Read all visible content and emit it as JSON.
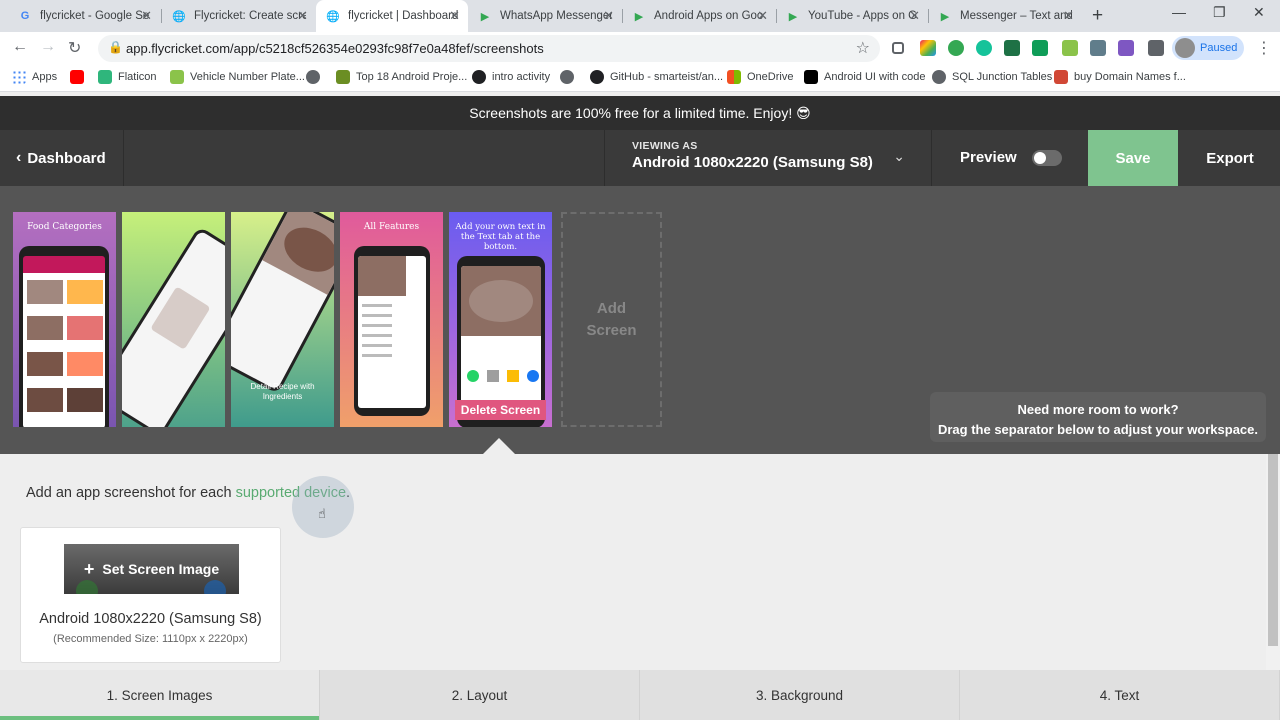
{
  "browser": {
    "tabs": [
      {
        "title": "flycricket - Google Se",
        "icon": "google-icon"
      },
      {
        "title": "Flycricket: Create scre",
        "icon": "globe-icon"
      },
      {
        "title": "flycricket | Dashboard",
        "icon": "globe-icon",
        "active": true
      },
      {
        "title": "WhatsApp Messenger",
        "icon": "play-store-icon"
      },
      {
        "title": "Android Apps on Goo",
        "icon": "play-store-icon"
      },
      {
        "title": "YouTube - Apps on G",
        "icon": "play-store-icon"
      },
      {
        "title": "Messenger – Text and",
        "icon": "play-store-icon"
      }
    ],
    "url": "app.flycricket.com/app/c5218cf526354e0293fc98f7e0a48fef/screenshots",
    "profile_label": "Paused",
    "bookmarks": [
      {
        "label": "Apps",
        "icon": "apps-grid-icon",
        "color": "#4285f4"
      },
      {
        "label": "",
        "icon": "youtube-icon",
        "color": "#ff0000"
      },
      {
        "label": "Flaticon",
        "icon": "flaticon-icon",
        "color": "#2fb67c"
      },
      {
        "label": "Vehicle Number Plate...",
        "icon": "vehicle-icon",
        "color": "#8bc34a"
      },
      {
        "label": "",
        "icon": "globe-icon",
        "color": "#5f6368"
      },
      {
        "label": "Top 18 Android Proje...",
        "icon": "project-icon",
        "color": "#6b8e23"
      },
      {
        "label": "intro activity",
        "icon": "github-icon",
        "color": "#202124"
      },
      {
        "label": "",
        "icon": "globe-icon",
        "color": "#5f6368"
      },
      {
        "label": "GitHub - smarteist/an...",
        "icon": "github-icon",
        "color": "#202124"
      },
      {
        "label": "OneDrive",
        "icon": "microsoft-icon",
        "color": "#f25022"
      },
      {
        "label": "Android UI with code",
        "icon": "medium-icon",
        "color": "#000000"
      },
      {
        "label": "SQL Junction Tables",
        "icon": "globe-icon",
        "color": "#5f6368"
      },
      {
        "label": "buy Domain Names f...",
        "icon": "domain-icon",
        "color": "#d14836"
      }
    ]
  },
  "banner": {
    "text": "Screenshots are 100% free for a limited time. Enjoy! 😎"
  },
  "header": {
    "back_label": "Dashboard",
    "viewing_label": "VIEWING AS",
    "viewing_value": "Android 1080x2220 (Samsung S8)",
    "preview_label": "Preview",
    "save_label": "Save",
    "export_label": "Export",
    "accent": "#7fc48f"
  },
  "screens": [
    {
      "caption": "Food Categories",
      "bg_top": "#b46fc0",
      "bg_bottom": "#7a55b0"
    },
    {
      "caption": "",
      "bg_top": "#c6f07a",
      "bg_bottom": "#4ea28b"
    },
    {
      "caption": "Detail Recipe with Ingredients",
      "bg_top": "#d7f08a",
      "bg_bottom": "#3f9b8c"
    },
    {
      "caption": "All Features",
      "bg_top": "#e05a9c",
      "bg_bottom": "#f0a06a"
    },
    {
      "caption": "Add your own text in the Text tab at the bottom.",
      "bg_top": "#6a5cf0",
      "bg_bottom": "#c86fd0",
      "delete_label": "Delete Screen"
    }
  ],
  "add_screen_label": "Add Screen",
  "hint": {
    "line1": "Need more room to work?",
    "line2": "Drag the separator below to adjust your workspace."
  },
  "content": {
    "intro_text": "Add an app screenshot for each ",
    "intro_link": "supported device",
    "intro_end": ".",
    "set_image_label": "Set Screen Image",
    "device_name": "Android 1080x2220 (Samsung S8)",
    "device_size": "(Recommended Size: 1110px x 2220px)"
  },
  "steps": [
    {
      "label": "1. Screen Images",
      "active": true
    },
    {
      "label": "2. Layout"
    },
    {
      "label": "3. Background"
    },
    {
      "label": "4. Text"
    }
  ]
}
